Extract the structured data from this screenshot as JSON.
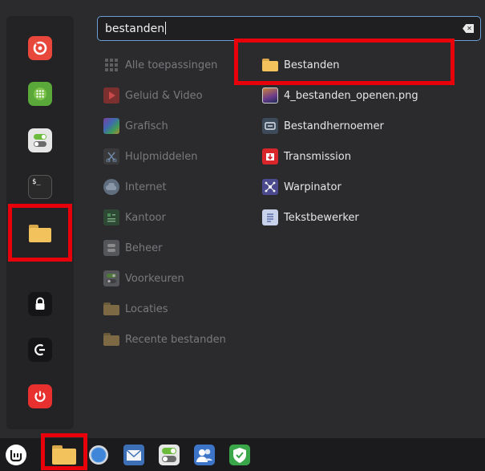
{
  "search": {
    "value": "bestanden"
  },
  "categories": [
    {
      "label": "Alle toepassingen",
      "icon": "grid-icon"
    },
    {
      "label": "Geluid & Video",
      "icon": "play-icon"
    },
    {
      "label": "Grafisch",
      "icon": "graphics-icon"
    },
    {
      "label": "Hulpmiddelen",
      "icon": "scissors-icon"
    },
    {
      "label": "Internet",
      "icon": "cloud-icon"
    },
    {
      "label": "Kantoor",
      "icon": "office-icon"
    },
    {
      "label": "Beheer",
      "icon": "admin-icon"
    },
    {
      "label": "Voorkeuren",
      "icon": "toggle-icon"
    },
    {
      "label": "Locaties",
      "icon": "folder-icon"
    },
    {
      "label": "Recente bestanden",
      "icon": "recent-folder-icon"
    }
  ],
  "results": [
    {
      "label": "Bestanden",
      "icon": "folder-icon"
    },
    {
      "label": "4_bestanden_openen.png",
      "icon": "image-icon"
    },
    {
      "label": "Bestandhernoemer",
      "icon": "renamer-icon"
    },
    {
      "label": "Transmission",
      "icon": "transmission-icon"
    },
    {
      "label": "Warpinator",
      "icon": "warpinator-icon"
    },
    {
      "label": "Tekstbewerker",
      "icon": "text-editor-icon"
    }
  ],
  "favorites": [
    {
      "name": "Firefox",
      "icon": "firefox-icon"
    },
    {
      "name": "Rekenmachine",
      "icon": "calculator-icon"
    },
    {
      "name": "Instellingen",
      "icon": "settings-toggle-icon"
    },
    {
      "name": "Terminal",
      "icon": "terminal-icon"
    },
    {
      "name": "Bestanden",
      "icon": "folder-icon"
    },
    {
      "name": "Vergrendelen",
      "icon": "lock-icon"
    },
    {
      "name": "Afmelden",
      "icon": "logout-icon"
    },
    {
      "name": "Afsluiten",
      "icon": "power-icon"
    }
  ],
  "terminal_prompt": "$_",
  "taskbar": [
    {
      "name": "menu",
      "icon": "mint-logo-icon"
    },
    {
      "name": "files",
      "icon": "folder-icon"
    },
    {
      "name": "browser",
      "icon": "globe-icon"
    },
    {
      "name": "mail",
      "icon": "mail-icon"
    },
    {
      "name": "settings",
      "icon": "settings-toggle-icon"
    },
    {
      "name": "users",
      "icon": "users-icon"
    },
    {
      "name": "shield",
      "icon": "shield-icon"
    }
  ],
  "colors": {
    "highlight": "#e8000b",
    "accent": "#6a9fd6",
    "folder": "#f2c25d"
  }
}
